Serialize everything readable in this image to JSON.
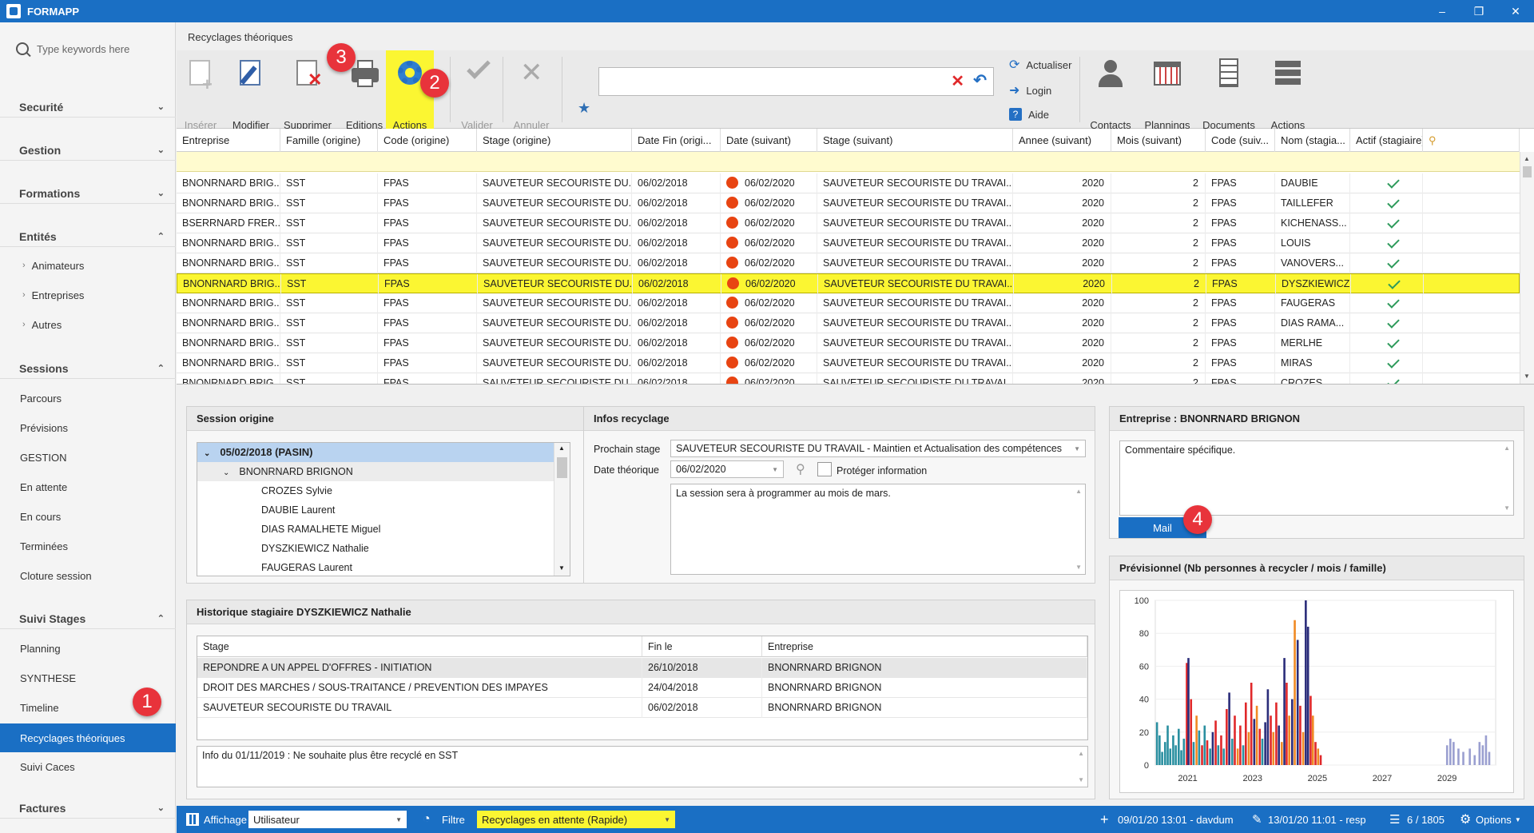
{
  "app": {
    "title": "FORMAPP",
    "window_controls": [
      "–",
      "❐",
      "✕"
    ]
  },
  "sidebar": {
    "search_placeholder": "Type keywords here",
    "sections": [
      {
        "label": "Securité",
        "chev": "⌄"
      },
      {
        "label": "Gestion",
        "chev": "⌄"
      },
      {
        "label": "Formations",
        "chev": "⌄"
      },
      {
        "label": "Entités",
        "chev": "⌃"
      },
      {
        "label": "Sessions",
        "chev": "⌃"
      },
      {
        "label": "Suivi Stages",
        "chev": "⌃"
      },
      {
        "label": "Factures",
        "chev": "⌄"
      }
    ],
    "entites_items": [
      "Animateurs",
      "Entreprises",
      "Autres"
    ],
    "sessions_items": [
      "Parcours",
      "Prévisions",
      "GESTION",
      "En attente",
      "En cours",
      "Terminées",
      "Cloture session"
    ],
    "suivi_items": [
      "Planning",
      "SYNTHESE",
      "Timeline",
      "Recyclages théoriques",
      "Suivi Caces"
    ]
  },
  "badges": [
    "1",
    "2",
    "3",
    "4"
  ],
  "page": {
    "title": "Recyclages théoriques"
  },
  "ribbon": {
    "buttons": [
      "Insérer",
      "Modifier",
      "Supprimer",
      "Editions",
      "Actions",
      "Valider",
      "Annuler"
    ],
    "small_buttons": [
      "Actualiser",
      "Login",
      "Aide"
    ],
    "right_buttons": [
      "Contacts",
      "Plannings",
      "Documents",
      "Actions"
    ],
    "search_value": ""
  },
  "grid": {
    "headers": [
      "Entreprise",
      "Famille (origine)",
      "Code (origine)",
      "Stage (origine)",
      "Date Fin (origi...",
      "Date (suivant)",
      "Stage (suivant)",
      "Annee (suivant)",
      "Mois (suivant)",
      "Code (suiv...",
      "Nom (stagia...",
      "Actif (stagiaire)"
    ],
    "rows": [
      [
        "BNONRNARD BRIG...",
        "SST",
        "FPAS",
        "SAUVETEUR SECOURISTE DU...",
        "06/02/2018",
        "06/02/2020",
        "SAUVETEUR SECOURISTE DU TRAVAI...",
        "2020",
        "2",
        "FPAS",
        "DAUBIE"
      ],
      [
        "BNONRNARD BRIG...",
        "SST",
        "FPAS",
        "SAUVETEUR SECOURISTE DU...",
        "06/02/2018",
        "06/02/2020",
        "SAUVETEUR SECOURISTE DU TRAVAI...",
        "2020",
        "2",
        "FPAS",
        "TAILLEFER"
      ],
      [
        "BSERRNARD FRER...",
        "SST",
        "FPAS",
        "SAUVETEUR SECOURISTE DU...",
        "06/02/2018",
        "06/02/2020",
        "SAUVETEUR SECOURISTE DU TRAVAI...",
        "2020",
        "2",
        "FPAS",
        "KICHENASS..."
      ],
      [
        "BNONRNARD BRIG...",
        "SST",
        "FPAS",
        "SAUVETEUR SECOURISTE DU...",
        "06/02/2018",
        "06/02/2020",
        "SAUVETEUR SECOURISTE DU TRAVAI...",
        "2020",
        "2",
        "FPAS",
        "LOUIS"
      ],
      [
        "BNONRNARD BRIG...",
        "SST",
        "FPAS",
        "SAUVETEUR SECOURISTE DU...",
        "06/02/2018",
        "06/02/2020",
        "SAUVETEUR SECOURISTE DU TRAVAI...",
        "2020",
        "2",
        "FPAS",
        "VANOVERS..."
      ],
      [
        "BNONRNARD BRIG...",
        "SST",
        "FPAS",
        "SAUVETEUR SECOURISTE DU...",
        "06/02/2018",
        "06/02/2020",
        "SAUVETEUR SECOURISTE DU TRAVAI...",
        "2020",
        "2",
        "FPAS",
        "DYSZKIEWICZ"
      ],
      [
        "BNONRNARD BRIG...",
        "SST",
        "FPAS",
        "SAUVETEUR SECOURISTE DU...",
        "06/02/2018",
        "06/02/2020",
        "SAUVETEUR SECOURISTE DU TRAVAI...",
        "2020",
        "2",
        "FPAS",
        "FAUGERAS"
      ],
      [
        "BNONRNARD BRIG...",
        "SST",
        "FPAS",
        "SAUVETEUR SECOURISTE DU...",
        "06/02/2018",
        "06/02/2020",
        "SAUVETEUR SECOURISTE DU TRAVAI...",
        "2020",
        "2",
        "FPAS",
        "DIAS RAMA..."
      ],
      [
        "BNONRNARD BRIG...",
        "SST",
        "FPAS",
        "SAUVETEUR SECOURISTE DU...",
        "06/02/2018",
        "06/02/2020",
        "SAUVETEUR SECOURISTE DU TRAVAI...",
        "2020",
        "2",
        "FPAS",
        "MERLHE"
      ],
      [
        "BNONRNARD BRIG...",
        "SST",
        "FPAS",
        "SAUVETEUR SECOURISTE DU...",
        "06/02/2018",
        "06/02/2020",
        "SAUVETEUR SECOURISTE DU TRAVAI...",
        "2020",
        "2",
        "FPAS",
        "MIRAS"
      ]
    ],
    "selected_row": 5,
    "partial_row": [
      "BNONRNARD BRIG...",
      "SST",
      "FPAS",
      "SAUVETEUR SECOURISTE DU...",
      "06/02/2018",
      "06/02/2020",
      "SAUVETEUR SECOURISTE DU TRAVAI...",
      "2020",
      "2",
      "FPAS",
      "CROZES"
    ]
  },
  "session_origine": {
    "title": "Session origine",
    "root": "05/02/2018 (PASIN)",
    "company": "BNONRNARD BRIGNON",
    "people": [
      "CROZES Sylvie",
      "DAUBIE Laurent",
      "DIAS RAMALHETE Miguel",
      "DYSZKIEWICZ Nathalie",
      "FAUGERAS Laurent"
    ]
  },
  "infos_recyclage": {
    "title": "Infos recyclage",
    "prochain_label": "Prochain stage",
    "prochain_value": "SAUVETEUR SECOURISTE DU TRAVAIL - Maintien et Actualisation des compétences",
    "date_label": "Date théorique",
    "date_value": "06/02/2020",
    "proteger_label": "Protéger information",
    "note": "La session sera à programmer au mois de mars."
  },
  "entreprise": {
    "title": "Entreprise : BNONRNARD BRIGNON",
    "comment": "Commentaire spécifique.",
    "mail_label": "Mail"
  },
  "historique": {
    "title": "Historique stagiaire DYSZKIEWICZ Nathalie",
    "headers": [
      "Stage",
      "Fin le",
      "Entreprise"
    ],
    "rows": [
      [
        "REPONDRE A UN APPEL D'OFFRES - INITIATION",
        "26/10/2018",
        "BNONRNARD BRIGNON"
      ],
      [
        "DROIT DES MARCHES / SOUS-TRAITANCE / PREVENTION DES IMPAYES",
        "24/04/2018",
        "BNONRNARD BRIGNON"
      ],
      [
        "SAUVETEUR SECOURISTE DU TRAVAIL",
        "06/02/2018",
        "BNONRNARD BRIGNON"
      ]
    ],
    "info": "Info du 01/11/2019 : Ne souhaite plus être recyclé en SST"
  },
  "chart_data": {
    "type": "bar",
    "title": "Prévisionnel (Nb personnes à recycler / mois /  famille)",
    "xlabel": "",
    "ylabel": "",
    "ylim": [
      0,
      100
    ],
    "yticks": [
      0,
      20,
      40,
      60,
      80,
      100
    ],
    "xticks": [
      "2021",
      "2023",
      "2025",
      "2027",
      "2029"
    ],
    "xrange": [
      2020.0,
      2030.5
    ],
    "series_colors": [
      "#2a8fa0",
      "#e0282a",
      "#2b2d7a",
      "#f08a24",
      "#9a9fd0"
    ],
    "bars": [
      {
        "x": 2020.05,
        "y": 26,
        "s": 0
      },
      {
        "x": 2020.13,
        "y": 18,
        "s": 0
      },
      {
        "x": 2020.21,
        "y": 8,
        "s": 0
      },
      {
        "x": 2020.3,
        "y": 14,
        "s": 0
      },
      {
        "x": 2020.38,
        "y": 24,
        "s": 0
      },
      {
        "x": 2020.46,
        "y": 10,
        "s": 0
      },
      {
        "x": 2020.55,
        "y": 18,
        "s": 0
      },
      {
        "x": 2020.63,
        "y": 12,
        "s": 0
      },
      {
        "x": 2020.72,
        "y": 22,
        "s": 0
      },
      {
        "x": 2020.8,
        "y": 9,
        "s": 0
      },
      {
        "x": 2020.88,
        "y": 16,
        "s": 0
      },
      {
        "x": 2020.97,
        "y": 62,
        "s": 1
      },
      {
        "x": 2021.02,
        "y": 65,
        "s": 2
      },
      {
        "x": 2021.1,
        "y": 40,
        "s": 1
      },
      {
        "x": 2021.18,
        "y": 14,
        "s": 0
      },
      {
        "x": 2021.27,
        "y": 30,
        "s": 3
      },
      {
        "x": 2021.35,
        "y": 21,
        "s": 0
      },
      {
        "x": 2021.44,
        "y": 12,
        "s": 1
      },
      {
        "x": 2021.52,
        "y": 24,
        "s": 0
      },
      {
        "x": 2021.6,
        "y": 15,
        "s": 1
      },
      {
        "x": 2021.69,
        "y": 10,
        "s": 0
      },
      {
        "x": 2021.77,
        "y": 20,
        "s": 2
      },
      {
        "x": 2021.86,
        "y": 27,
        "s": 1
      },
      {
        "x": 2021.94,
        "y": 12,
        "s": 0
      },
      {
        "x": 2022.03,
        "y": 18,
        "s": 1
      },
      {
        "x": 2022.11,
        "y": 10,
        "s": 0
      },
      {
        "x": 2022.2,
        "y": 34,
        "s": 1
      },
      {
        "x": 2022.28,
        "y": 44,
        "s": 2
      },
      {
        "x": 2022.37,
        "y": 16,
        "s": 0
      },
      {
        "x": 2022.45,
        "y": 30,
        "s": 1
      },
      {
        "x": 2022.54,
        "y": 10,
        "s": 3
      },
      {
        "x": 2022.62,
        "y": 24,
        "s": 1
      },
      {
        "x": 2022.71,
        "y": 12,
        "s": 0
      },
      {
        "x": 2022.79,
        "y": 38,
        "s": 1
      },
      {
        "x": 2022.88,
        "y": 20,
        "s": 3
      },
      {
        "x": 2022.96,
        "y": 50,
        "s": 1
      },
      {
        "x": 2023.05,
        "y": 28,
        "s": 2
      },
      {
        "x": 2023.13,
        "y": 36,
        "s": 3
      },
      {
        "x": 2023.22,
        "y": 22,
        "s": 1
      },
      {
        "x": 2023.3,
        "y": 16,
        "s": 0
      },
      {
        "x": 2023.39,
        "y": 26,
        "s": 2
      },
      {
        "x": 2023.47,
        "y": 46,
        "s": 2
      },
      {
        "x": 2023.56,
        "y": 30,
        "s": 1
      },
      {
        "x": 2023.64,
        "y": 20,
        "s": 3
      },
      {
        "x": 2023.73,
        "y": 38,
        "s": 1
      },
      {
        "x": 2023.81,
        "y": 24,
        "s": 2
      },
      {
        "x": 2023.9,
        "y": 14,
        "s": 3
      },
      {
        "x": 2023.98,
        "y": 65,
        "s": 2
      },
      {
        "x": 2024.05,
        "y": 50,
        "s": 1
      },
      {
        "x": 2024.13,
        "y": 30,
        "s": 3
      },
      {
        "x": 2024.22,
        "y": 40,
        "s": 2
      },
      {
        "x": 2024.3,
        "y": 88,
        "s": 3
      },
      {
        "x": 2024.39,
        "y": 76,
        "s": 2
      },
      {
        "x": 2024.47,
        "y": 36,
        "s": 1
      },
      {
        "x": 2024.56,
        "y": 20,
        "s": 3
      },
      {
        "x": 2024.64,
        "y": 102,
        "s": 2
      },
      {
        "x": 2024.71,
        "y": 84,
        "s": 2
      },
      {
        "x": 2024.79,
        "y": 42,
        "s": 1
      },
      {
        "x": 2024.86,
        "y": 30,
        "s": 3
      },
      {
        "x": 2024.94,
        "y": 14,
        "s": 1
      },
      {
        "x": 2025.02,
        "y": 10,
        "s": 3
      },
      {
        "x": 2025.1,
        "y": 6,
        "s": 1
      },
      {
        "x": 2029.0,
        "y": 12,
        "s": 4
      },
      {
        "x": 2029.1,
        "y": 16,
        "s": 4
      },
      {
        "x": 2029.2,
        "y": 14,
        "s": 4
      },
      {
        "x": 2029.35,
        "y": 10,
        "s": 4
      },
      {
        "x": 2029.5,
        "y": 8,
        "s": 4
      },
      {
        "x": 2029.7,
        "y": 10,
        "s": 4
      },
      {
        "x": 2029.85,
        "y": 6,
        "s": 4
      },
      {
        "x": 2030.0,
        "y": 14,
        "s": 4
      },
      {
        "x": 2030.1,
        "y": 12,
        "s": 4
      },
      {
        "x": 2030.2,
        "y": 18,
        "s": 4
      },
      {
        "x": 2030.3,
        "y": 8,
        "s": 4
      }
    ]
  },
  "statusbar": {
    "affichage_label": "Affichage",
    "affichage_value": "Utilisateur",
    "filtre_label": "Filtre",
    "filtre_value": "Recyclages en attente (Rapide)",
    "created": "09/01/20 13:01 - davdum",
    "modified": "13/01/20 11:01 - resp",
    "count": "6 / 1805",
    "options": "Options"
  }
}
